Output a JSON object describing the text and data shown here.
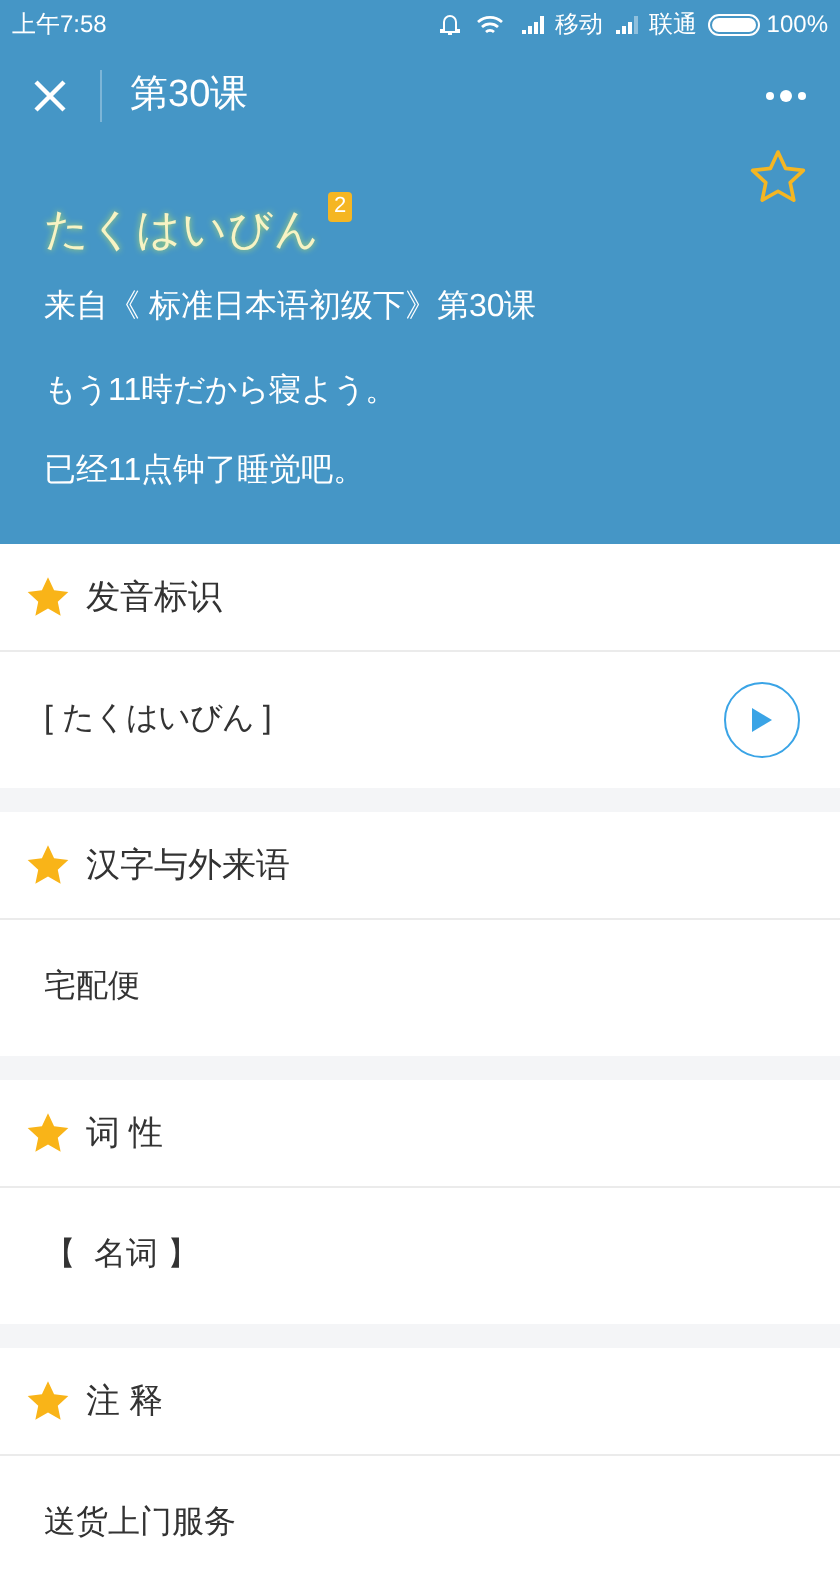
{
  "status_bar": {
    "time": "上午7:58",
    "carrier_1": "移动",
    "carrier_2": "联通",
    "battery": "100%"
  },
  "header": {
    "title": "第30课"
  },
  "word": {
    "kana": "たくはいびん",
    "badge": "2",
    "favorited": false,
    "source": "来自《 标准日本语初级下》第30课",
    "example_ja": "もう11時だから寝よう。",
    "example_zh": "已经11点钟了睡觉吧。"
  },
  "sections": [
    {
      "title": "发音标识",
      "kind": "audio",
      "content": "[ たくはいびん ]"
    },
    {
      "title": "汉字与外来语",
      "kind": "text",
      "content": "宅配便"
    },
    {
      "title": "词 性",
      "kind": "text",
      "content": "【  名词 】"
    },
    {
      "title": "注 释",
      "kind": "text",
      "content": "送货上门服务"
    }
  ]
}
